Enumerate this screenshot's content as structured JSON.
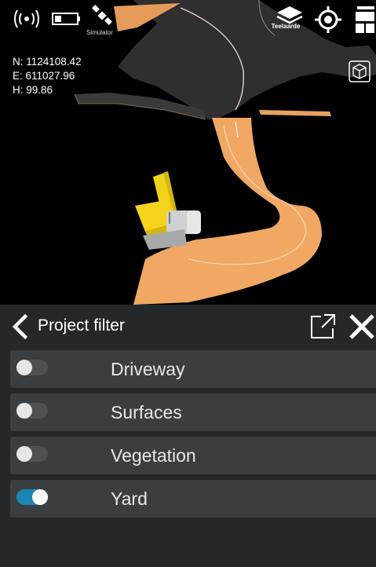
{
  "status": {
    "simulator_label": "Simulator",
    "layer_label": "Teelaarde"
  },
  "coordinates": {
    "north": "N: 1124108.42",
    "east": "E: 611027.96",
    "height": "H: 99.86"
  },
  "panel": {
    "title": "Project filter"
  },
  "filters": [
    {
      "label": "Driveway",
      "enabled": false
    },
    {
      "label": "Surfaces",
      "enabled": false
    },
    {
      "label": "Vegetation",
      "enabled": false
    },
    {
      "label": "Yard",
      "enabled": true
    }
  ],
  "colors": {
    "surface": "#f0a864",
    "toggle_on": "#1e86b3",
    "panel_bg": "#24282b",
    "row_bg": "#3a3e41"
  }
}
